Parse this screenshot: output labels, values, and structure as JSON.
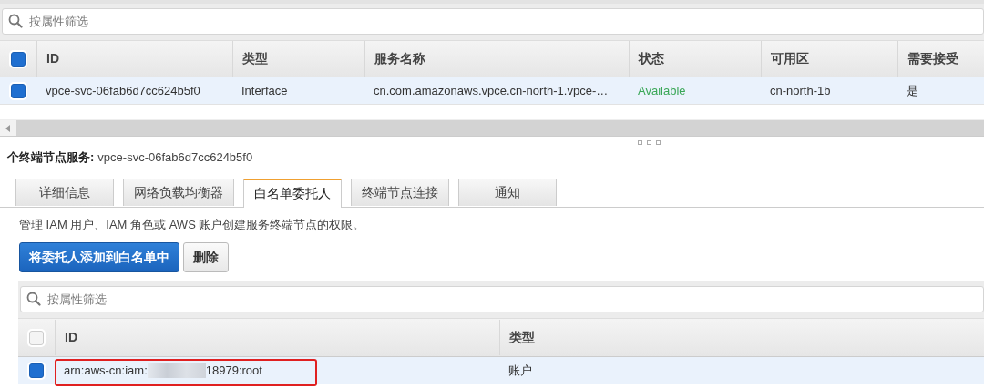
{
  "services_filter": {
    "placeholder": "按属性筛选"
  },
  "services_table": {
    "all_selected": true,
    "columns": [
      "ID",
      "类型",
      "服务名称",
      "状态",
      "可用区",
      "需要接受"
    ],
    "rows": [
      {
        "selected": true,
        "cells": [
          "vpce-svc-06fab6d7cc624b5f0",
          "Interface",
          "cn.com.amazonaws.vpce.cn-north-1.vpce-…",
          {
            "text": "Available",
            "kind": "available"
          },
          "cn-north-1b",
          "是"
        ]
      }
    ]
  },
  "details": {
    "label": "个终端节点服务:",
    "value": "vpce-svc-06fab6d7cc624b5f0"
  },
  "tabs": [
    {
      "label": "详细信息",
      "selected": false
    },
    {
      "label": "网络负载均衡器",
      "selected": false
    },
    {
      "label": "白名单委托人",
      "selected": true
    },
    {
      "label": "终端节点连接",
      "selected": false
    },
    {
      "label": "通知",
      "selected": false
    }
  ],
  "description": "管理 IAM 用户、IAM 角色或 AWS 账户创建服务终端节点的权限。",
  "buttons": [
    {
      "label": "将委托人添加到白名单中",
      "kind": "primary"
    },
    {
      "label": "删除",
      "kind": "secondary"
    }
  ],
  "principals_filter": {
    "placeholder": "按属性筛选"
  },
  "principals_table": {
    "all_selected": false,
    "columns": [
      "ID",
      "类型"
    ],
    "rows": [
      {
        "selected": true,
        "id_start": "arn:aws-cn:iam:",
        "redacted": true,
        "id_end": "18979:root",
        "type": "账户",
        "highlighted": true
      }
    ]
  }
}
